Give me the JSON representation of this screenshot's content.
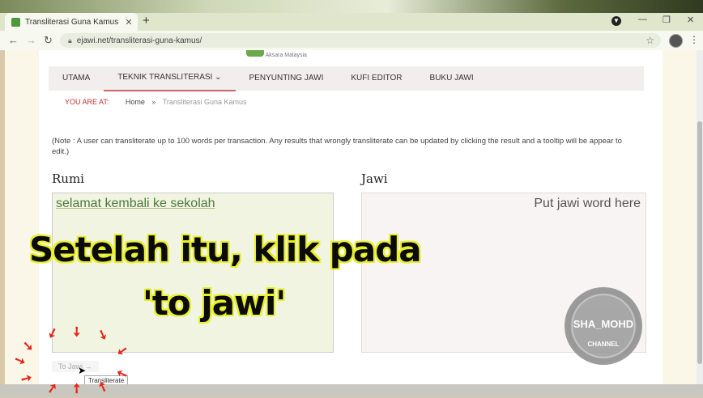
{
  "browser": {
    "tab_title": "Transliterasi Guna Kamus",
    "url": "ejawi.net/transliterasi-guna-kamus/"
  },
  "site": {
    "logo_subtext": "Aksara Malaysia",
    "menu": [
      "UTAMA",
      "TEKNIK TRANSLITERASI",
      "PENYUNTING JAWI",
      "KUFI EDITOR",
      "BUKU JAWI"
    ],
    "breadcrumb": {
      "prefix": "YOU ARE AT:",
      "home": "Home",
      "separator": "»",
      "current": "Transliterasi Guna Kamus"
    },
    "note": "(Note : A user can transliterate up to 100 words per transaction. Any results that wrongly transliterate can be updated by clicking the result and a tooltip will be appear to edit.)",
    "rumi_label": "Rumi",
    "rumi_value": "selamat kembali ke sekolah",
    "jawi_label": "Jawi",
    "jawi_placeholder": "Put jawi word here",
    "to_jawi_button": "To Jawi →",
    "tooltip": "Transliterate"
  },
  "overlay": {
    "caption_line1": "Setelah itu, klik pada",
    "caption_line2": "'to jawi'",
    "watermark_line1": "SHA_MOHD",
    "watermark_line2": "CHANNEL"
  },
  "colors": {
    "caption_outline": "#e8f02a",
    "arrow": "#e8231a",
    "menu_active_underline": "#cc6666"
  }
}
